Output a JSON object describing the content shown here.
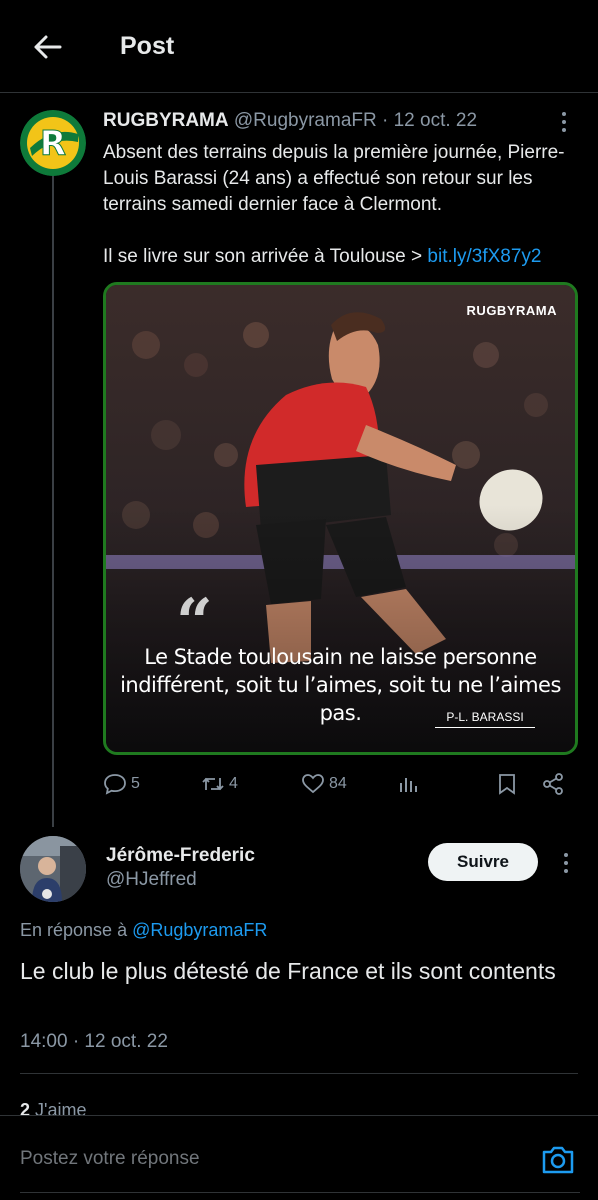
{
  "header": {
    "title": "Post",
    "back_icon": "arrow-left-icon"
  },
  "tweet": {
    "name": "RUGBYRAMA",
    "handle": "@RugbyramaFR",
    "separator": "·",
    "date": "12 oct. 22",
    "text_line1": "Absent des terrains depuis la première journée, Pierre-Louis Barassi (24 ans) a effectué son retour sur les terrains samedi dernier face à Clermont.",
    "text_line2": "Il se livre sur son arrivée à Toulouse >",
    "link": "bit.ly/3fX87y2",
    "media": {
      "brand": "RUGBYRAMA",
      "quote_mark": "“",
      "quote": "Le Stade toulousain ne laisse personne indifférent, soit tu l’aimes, soit tu ne l’aimes pas.",
      "author": "P-L. BARASSI",
      "border_color": "#1f7a1f"
    },
    "actions": {
      "replies": "5",
      "retweets": "4",
      "likes": "84"
    }
  },
  "reply": {
    "name": "Jérôme-Frederic",
    "handle": "@HJeffred",
    "follow_label": "Suivre",
    "in_reply_prefix": "En réponse à",
    "in_reply_mention": "@RugbyramaFR",
    "text": "Le club le plus détesté de France et ils sont contents",
    "time": "14:00 · 12 oct. 22",
    "likes_count": "2",
    "likes_label": "J'aime"
  },
  "composer": {
    "placeholder": "Postez votre réponse"
  },
  "colors": {
    "accent": "#1d9bf0",
    "muted": "#8b98a5",
    "background": "#000000"
  }
}
